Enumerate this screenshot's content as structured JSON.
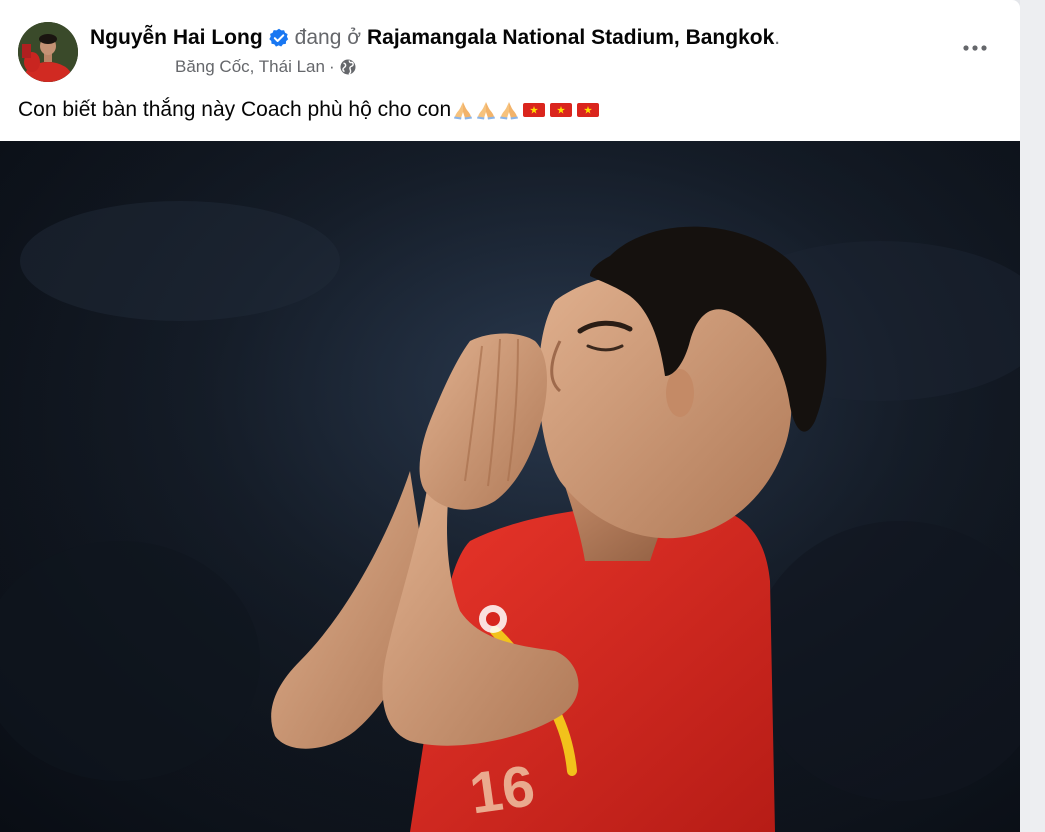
{
  "post": {
    "author": {
      "name": "Nguyễn Hai Long",
      "verified": true,
      "verified_icon": "verified-badge-icon",
      "at_text": "đang ở",
      "place": "Rajamangala National Stadium, Bangkok",
      "place_suffix": "."
    },
    "meta": {
      "location": "Băng Cốc, Thái Lan",
      "separator": "·",
      "audience_icon": "globe-icon"
    },
    "more_icon": "more-options-icon",
    "caption": "Con biết bàn thắng này Coach phù hộ cho con",
    "caption_emojis": [
      "folded-hands-icon",
      "folded-hands-icon",
      "folded-hands-icon",
      "vietnam-flag-icon",
      "vietnam-flag-icon",
      "vietnam-flag-icon"
    ],
    "photo": {
      "jersey_number": "16"
    }
  },
  "colors": {
    "verified_blue": "#1877f2",
    "jersey_red": "#d7261e",
    "trim_yellow": "#f2c21b",
    "text_primary": "#050505",
    "text_secondary": "#65676b"
  }
}
